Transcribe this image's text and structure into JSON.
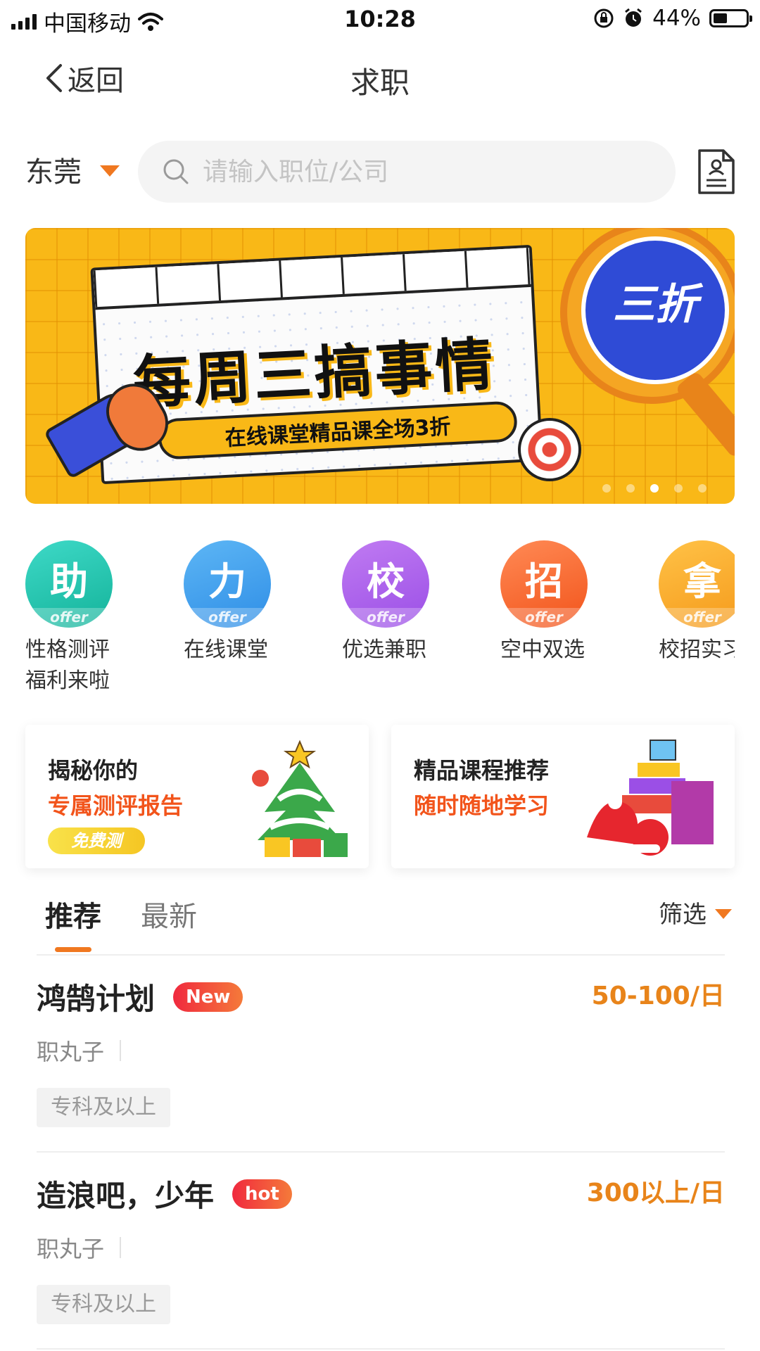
{
  "status_bar": {
    "carrier": "中国移动",
    "time": "10:28",
    "battery_text": "44%",
    "battery_level": 0.44
  },
  "nav": {
    "back_label": "返回",
    "title": "求职"
  },
  "search": {
    "city": "东莞",
    "placeholder": "请输入职位/公司"
  },
  "banner": {
    "headline": "每周三搞事情",
    "sub": "在线课堂精品课全场3折",
    "discount": "三折",
    "active_dot": 2,
    "dot_count": 5
  },
  "quick": [
    {
      "glyph": "助",
      "offer": "offer",
      "label": "性格测评\n福利来啦",
      "color_from": "#3ED9C7",
      "color_to": "#14B39A"
    },
    {
      "glyph": "力",
      "offer": "offer",
      "label": "在线课堂",
      "color_from": "#5DB6F5",
      "color_to": "#2F8EE6"
    },
    {
      "glyph": "校",
      "offer": "offer",
      "label": "优选兼职",
      "color_from": "#C07BF2",
      "color_to": "#9B4FE6"
    },
    {
      "glyph": "招",
      "offer": "offer",
      "label": "空中双选",
      "color_from": "#FF8A55",
      "color_to": "#F2541B"
    },
    {
      "glyph": "拿",
      "offer": "offer",
      "label": "校招实习",
      "color_from": "#FFC247",
      "color_to": "#F59A1B"
    }
  ],
  "promos": [
    {
      "line1": "揭秘你的",
      "line2": "专属测评报告",
      "chip": "免费测"
    },
    {
      "line1": "精品课程推荐",
      "line2": "随时随地学习"
    }
  ],
  "tabs": {
    "active": "推荐",
    "inactive": "最新",
    "filter": "筛选"
  },
  "jobs": [
    {
      "title": "鸿鹄计划",
      "badge": "New",
      "salary": "50-100/日",
      "company": "职丸子",
      "tag": "专科及以上"
    },
    {
      "title": "造浪吧，少年",
      "badge": "hot",
      "salary": "300以上/日",
      "company": "职丸子",
      "tag": "专科及以上"
    }
  ],
  "colors": {
    "accent": "#F07820",
    "salary": "#E8841A",
    "promo_red": "#F2541B"
  }
}
